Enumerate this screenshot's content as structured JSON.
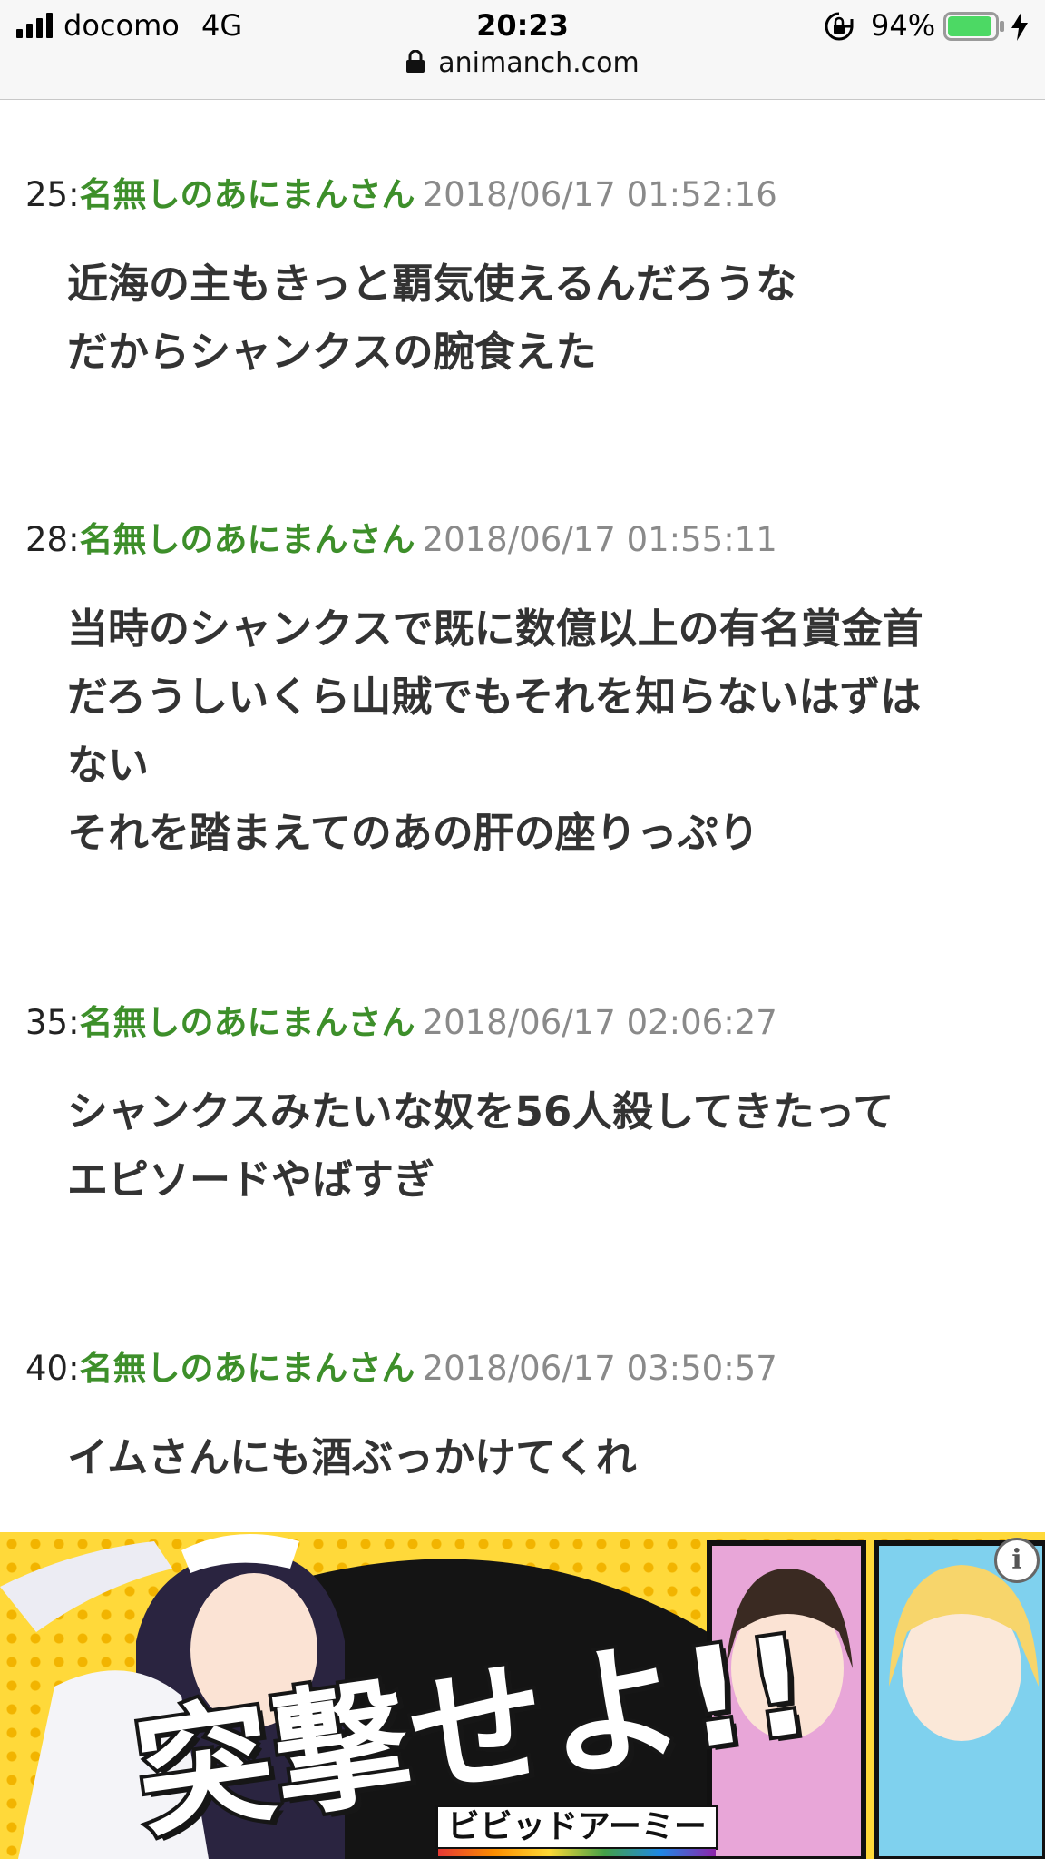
{
  "status_bar": {
    "carrier": "docomo",
    "network": "4G",
    "time": "20:23",
    "battery_percent": "94%",
    "battery_level": 0.94,
    "battery_color": "#4cd964"
  },
  "url_bar": {
    "domain": "animanch.com",
    "lock_icon": "lock-icon"
  },
  "posts": [
    {
      "number": "25:",
      "name": "名無しのあにまんさん",
      "date": "2018/06/17 01:52:16",
      "lines": [
        "近海の主もきっと覇気使えるんだろうな",
        "だからシャンクスの腕食えた"
      ]
    },
    {
      "number": "28:",
      "name": "名無しのあにまんさん",
      "date": "2018/06/17 01:55:11",
      "lines": [
        "当時のシャンクスで既に数億以上の有名賞金首",
        "だろうしいくら山賊でもそれを知らないはずは",
        "ない",
        "それを踏まえてのあの肝の座りっぷり"
      ]
    },
    {
      "number": "35:",
      "name": "名無しのあにまんさん",
      "date": "2018/06/17 02:06:27",
      "lines": [
        "シャンクスみたいな奴を56人殺してきたって",
        "エピソードやばすぎ"
      ]
    },
    {
      "number": "40:",
      "name": "名無しのあにまんさん",
      "date": "2018/06/17 03:50:57",
      "lines": [
        "イムさんにも酒ぶっかけてくれ"
      ]
    }
  ],
  "ad": {
    "headline": "突撃せよ!!",
    "logo_text": "ビビッドアーミー",
    "info_label": "i",
    "colors": {
      "background": "#ffd93a",
      "dots": "#f2b400"
    }
  }
}
